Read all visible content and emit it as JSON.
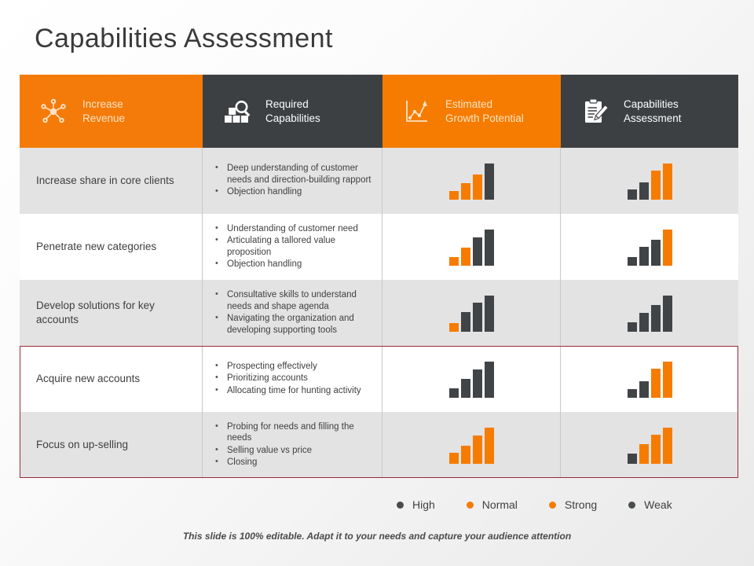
{
  "slide": {
    "title": "Capabilities  Assessment",
    "footer": "This slide is 100% editable. Adapt it to your needs and capture your audience attention",
    "accent_orange": "#f57c00",
    "accent_dark": "#3d4043",
    "highlight_border": "#9e2a3a"
  },
  "headers": [
    {
      "label": "Increase\nRevenue",
      "icon": "network-nodes-icon",
      "style": "orange"
    },
    {
      "label": "Required\nCapabilities",
      "icon": "magnifier-boxes-icon",
      "style": "dark"
    },
    {
      "label": "Estimated\nGrowth Potential",
      "icon": "line-chart-icon",
      "style": "orange"
    },
    {
      "label": "Capabilities\nAssessment",
      "icon": "clipboard-pencil-icon",
      "style": "dark"
    }
  ],
  "rows": [
    {
      "name": "Increase share in core clients",
      "capabilities": [
        "Deep understanding of customer needs and direction-building rapport",
        "Objection handling"
      ],
      "growth_potential": {
        "bars": [
          25,
          45,
          70,
          100
        ],
        "colors": [
          "o",
          "o",
          "o",
          "d"
        ]
      },
      "assessment": {
        "bars": [
          28,
          48,
          80,
          100
        ],
        "colors": [
          "d",
          "d",
          "o",
          "o"
        ]
      }
    },
    {
      "name": "Penetrate new categories",
      "capabilities": [
        "Understanding of customer need",
        "Articulating a tallored value proposition",
        "Objection handling"
      ],
      "growth_potential": {
        "bars": [
          25,
          50,
          78,
          100
        ],
        "colors": [
          "o",
          "o",
          "d",
          "d"
        ]
      },
      "assessment": {
        "bars": [
          25,
          52,
          72,
          100
        ],
        "colors": [
          "d",
          "d",
          "d",
          "o"
        ]
      }
    },
    {
      "name": "Develop solutions for key accounts",
      "capabilities": [
        "Consultative skills to understand needs and shape agenda",
        "Navigating the organization and developing supporting tools"
      ],
      "growth_potential": {
        "bars": [
          24,
          55,
          80,
          100
        ],
        "colors": [
          "o",
          "d",
          "d",
          "d"
        ]
      },
      "assessment": {
        "bars": [
          26,
          52,
          75,
          100
        ],
        "colors": [
          "d",
          "d",
          "d",
          "d"
        ]
      }
    },
    {
      "name": "Acquire new accounts",
      "capabilities": [
        "Prospecting effectively",
        "Prioritizing accounts",
        "Allocating time for hunting activity"
      ],
      "growth_potential": {
        "bars": [
          26,
          52,
          78,
          100
        ],
        "colors": [
          "d",
          "d",
          "d",
          "d"
        ]
      },
      "assessment": {
        "bars": [
          25,
          45,
          80,
          100
        ],
        "colors": [
          "d",
          "d",
          "o",
          "o"
        ]
      }
    },
    {
      "name": "Focus on up-selling",
      "capabilities": [
        "Probing for needs and filling the needs",
        "Selling value vs price",
        "Closing"
      ],
      "growth_potential": {
        "bars": [
          30,
          50,
          78,
          100
        ],
        "colors": [
          "o",
          "o",
          "o",
          "o"
        ]
      },
      "assessment": {
        "bars": [
          28,
          55,
          80,
          100
        ],
        "colors": [
          "d",
          "o",
          "o",
          "o"
        ]
      }
    }
  ],
  "legend": [
    {
      "label": "High",
      "color": "d"
    },
    {
      "label": "Normal",
      "color": "o"
    },
    {
      "label": "Strong",
      "color": "o"
    },
    {
      "label": "Weak",
      "color": "d"
    }
  ]
}
